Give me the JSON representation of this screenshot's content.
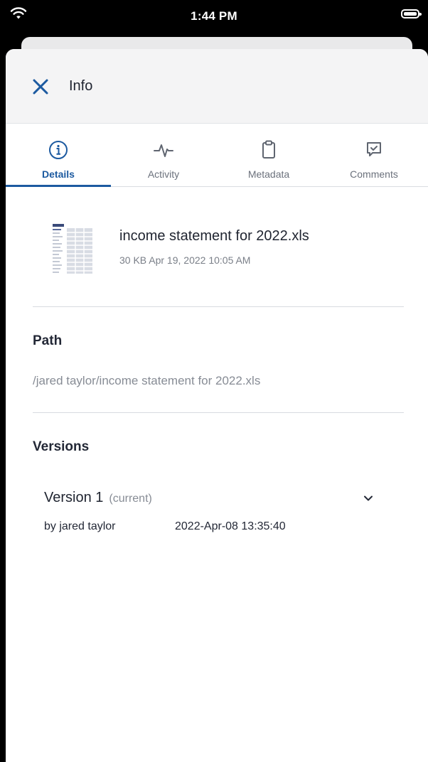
{
  "status_bar": {
    "time": "1:44 PM"
  },
  "header": {
    "title": "Info"
  },
  "tabs": [
    {
      "label": "Details",
      "icon": "info-icon",
      "active": true
    },
    {
      "label": "Activity",
      "icon": "activity-icon",
      "active": false
    },
    {
      "label": "Metadata",
      "icon": "clipboard-icon",
      "active": false
    },
    {
      "label": "Comments",
      "icon": "comment-check-icon",
      "active": false
    }
  ],
  "file": {
    "name": "income statement for 2022.xls",
    "meta": "30 KB Apr 19, 2022 10:05 AM"
  },
  "path": {
    "heading": "Path",
    "value": "/jared taylor/income statement for 2022.xls"
  },
  "versions": {
    "heading": "Versions",
    "items": [
      {
        "title": "Version 1",
        "tag": "(current)",
        "author": "by jared taylor",
        "date": "2022-Apr-08 13:35:40"
      }
    ]
  },
  "colors": {
    "accent": "#1c5aa0",
    "text_primary": "#1f2430",
    "text_secondary": "#878c95",
    "header_bg": "#f4f4f5"
  }
}
